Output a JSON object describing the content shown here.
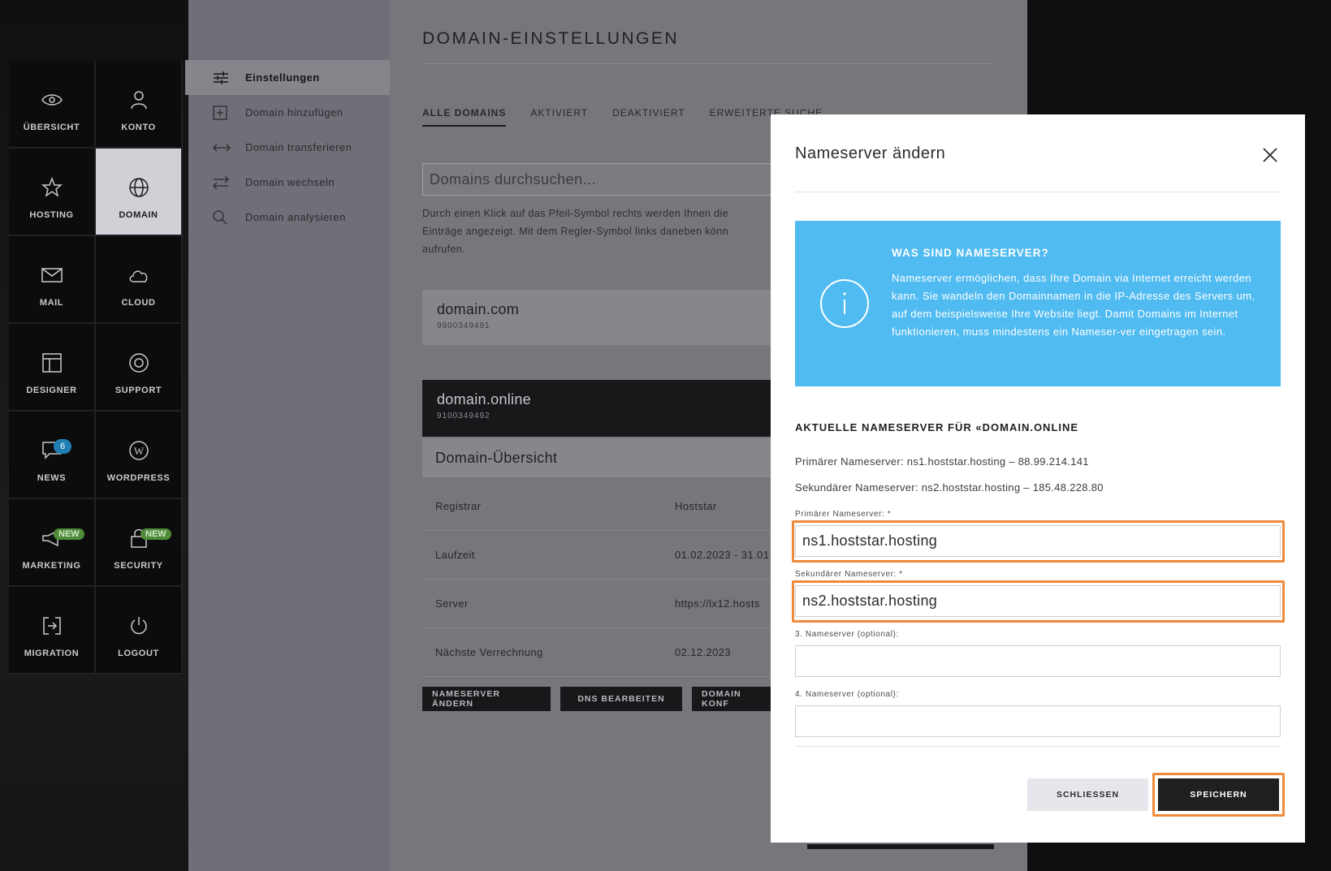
{
  "sidebar": {
    "tiles": [
      {
        "label": "ÜBERSICHT",
        "icon": "eye-icon"
      },
      {
        "label": "KONTO",
        "icon": "user-icon"
      },
      {
        "label": "HOSTING",
        "icon": "star-icon"
      },
      {
        "label": "DOMAIN",
        "icon": "globe-icon",
        "active": true
      },
      {
        "label": "MAIL",
        "icon": "mail-icon"
      },
      {
        "label": "CLOUD",
        "icon": "cloud-icon"
      },
      {
        "label": "DESIGNER",
        "icon": "layout-icon"
      },
      {
        "label": "SUPPORT",
        "icon": "lifebuoy-icon"
      },
      {
        "label": "NEWS",
        "icon": "chat-icon",
        "badge": "6"
      },
      {
        "label": "WORDPRESS",
        "icon": "wordpress-icon"
      },
      {
        "label": "MARKETING",
        "icon": "megaphone-icon",
        "badge": "NEW"
      },
      {
        "label": "SECURITY",
        "icon": "lock-icon",
        "badge": "NEW"
      },
      {
        "label": "MIGRATION",
        "icon": "migration-icon"
      },
      {
        "label": "LOGOUT",
        "icon": "power-icon"
      }
    ]
  },
  "subnav": {
    "items": [
      {
        "label": "Einstellungen",
        "icon": "sliders-icon"
      },
      {
        "label": "Domain hinzufügen",
        "icon": "plus-square-icon"
      },
      {
        "label": "Domain transferieren",
        "icon": "arrows-horizontal-icon"
      },
      {
        "label": "Domain wechseln",
        "icon": "swap-icon"
      },
      {
        "label": "Domain analysieren",
        "icon": "search-icon"
      }
    ]
  },
  "main": {
    "title": "DOMAIN-EINSTELLUNGEN",
    "tabs": [
      "ALLE DOMAINS",
      "AKTIVIERT",
      "DEAKTIVIERT",
      "ERWEITERTE SUCHE"
    ],
    "search_placeholder": "Domains durchsuchen...",
    "help_text": "Durch einen Klick auf das Pfeil-Symbol rechts werden Ihnen die Einträge angezeigt. Mit dem Regler-Symbol links daneben könn aufrufen.",
    "domains": [
      {
        "name": "domain.com",
        "id": "9900349491"
      },
      {
        "name": "domain.online",
        "id": "9100349492"
      }
    ],
    "overview_title": "Domain-Übersicht",
    "overview_rows": [
      {
        "key": "Registrar",
        "value": "Hoststar"
      },
      {
        "key": "Laufzeit",
        "value": "01.02.2023 - 31.01"
      },
      {
        "key": "Server",
        "value": "https://lx12.hosts"
      },
      {
        "key": "Nächste Verrechnung",
        "value": "02.12.2023"
      }
    ],
    "buttons": [
      "NAMESERVER ÄNDERN",
      "DNS BEARBEITEN",
      "DOMAIN KONF"
    ]
  },
  "modal": {
    "title": "Nameserver ändern",
    "info_heading": "WAS SIND NAMESERVER?",
    "info_text": "Nameserver ermöglichen, dass Ihre Domain via Internet erreicht werden kann. Sie wandeln den Domainnamen in die IP-Adresse des Servers um, auf dem beispielsweise Ihre Website liegt. Damit Domains im Internet funktionieren, muss mindestens ein Nameser-ver eingetragen sein.",
    "section_title": "AKTUELLE NAMESERVER FÜR «DOMAIN.ONLINE",
    "current_primary": "Primärer Nameserver: ns1.hoststar.hosting – 88.99.214.141",
    "current_secondary": "Sekundärer Nameserver: ns2.hoststar.hosting – 185.48.228.80",
    "fields": [
      {
        "label": "Primärer Nameserver: *",
        "value": "ns1.hoststar.hosting"
      },
      {
        "label": "Sekundärer Nameserver: *",
        "value": "ns2.hoststar.hosting"
      },
      {
        "label": "3. Nameserver (optional):",
        "value": ""
      },
      {
        "label": "4. Nameserver (optional):",
        "value": ""
      }
    ],
    "close_label": "SCHLIESSEN",
    "save_label": "SPEICHERN"
  },
  "colors": {
    "accent_info": "#50bbf1",
    "highlight": "#ef8a3a"
  }
}
